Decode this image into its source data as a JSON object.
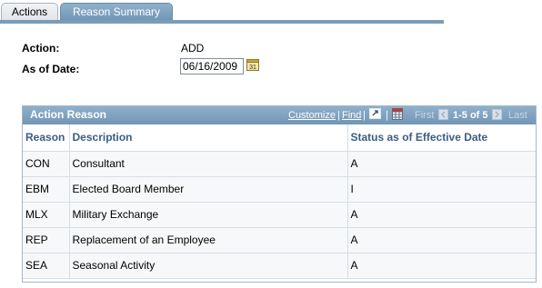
{
  "tabs": {
    "actions_label": "Actions",
    "reason_summary_label": "Reason Summary"
  },
  "form": {
    "action_label": "Action:",
    "action_value": "ADD",
    "as_of_date_label": "As of Date:",
    "as_of_date_value": "06/16/2009"
  },
  "grid": {
    "title": "Action Reason",
    "customize_label": "Customize",
    "find_label": "Find",
    "first_label": "First",
    "range_label": "1-5 of 5",
    "last_label": "Last",
    "columns": [
      "Reason",
      "Description",
      "Status as of Effective Date"
    ],
    "rows": [
      [
        "CON",
        "Consultant",
        "A"
      ],
      [
        "EBM",
        "Elected Board Member",
        "I"
      ],
      [
        "MLX",
        "Military Exchange",
        "A"
      ],
      [
        "REP",
        "Replacement of an Employee",
        "A"
      ],
      [
        "SEA",
        "Seasonal Activity",
        "A"
      ]
    ]
  },
  "colors": {
    "accent": "#7396b5",
    "header_text": "#3b5d80"
  },
  "icons": [
    "calendar-icon",
    "view-all-icon",
    "grid-download-icon",
    "first-arrow-icon",
    "last-arrow-icon"
  ]
}
